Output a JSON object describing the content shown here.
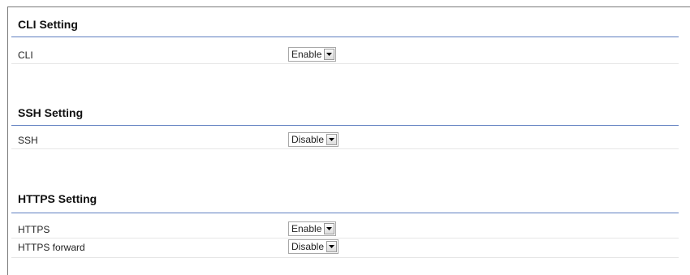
{
  "sections": [
    {
      "title": "CLI Setting",
      "rows": [
        {
          "label": "CLI",
          "value": "Enable"
        }
      ]
    },
    {
      "title": "SSH Setting",
      "rows": [
        {
          "label": "SSH",
          "value": "Disable"
        }
      ]
    },
    {
      "title": "HTTPS Setting",
      "rows": [
        {
          "label": "HTTPS",
          "value": "Enable"
        },
        {
          "label": "HTTPS forward",
          "value": "Disable"
        }
      ]
    }
  ],
  "colors": {
    "section_rule": "#5f7fc0",
    "row_rule": "#e6e6e6"
  },
  "icons": {
    "select_arrow": "triangle-down-icon"
  }
}
